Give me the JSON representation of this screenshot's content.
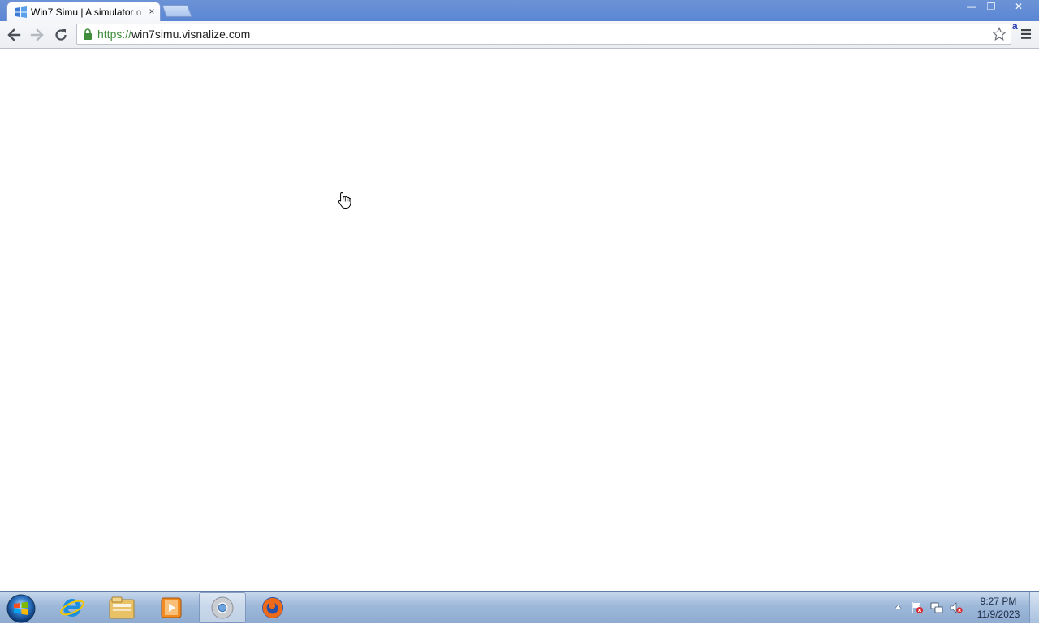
{
  "browser": {
    "tab": {
      "title": "Win7 Simu | A simulator o",
      "close_glyph": "×",
      "favicon": "windows-flag-icon"
    },
    "window_controls": {
      "minimize": "—",
      "maximize": "❐",
      "close": "✕"
    },
    "toolbar": {
      "back": "back-arrow-icon",
      "forward": "forward-arrow-icon",
      "reload": "reload-icon"
    },
    "address_bar": {
      "scheme": "https://",
      "host": "win7simu.visnalize.com",
      "secure": true
    },
    "extension_badge": "a"
  },
  "taskbar": {
    "pinned": [
      "internet-explorer-icon",
      "windows-explorer-icon",
      "media-player-icon",
      "chrome-icon",
      "firefox-icon"
    ],
    "active": "chrome-icon",
    "clock": {
      "time": "9:27 PM",
      "date": "11/9/2023"
    }
  },
  "colors": {
    "titlebar": "#5a86d4",
    "secure_scheme": "#3f8d3a",
    "taskbar": "#9db8d9"
  }
}
